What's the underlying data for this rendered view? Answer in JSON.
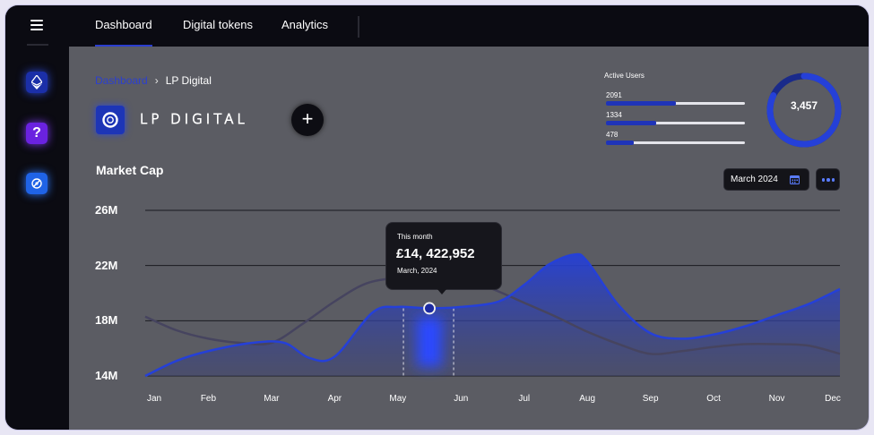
{
  "header": {
    "tabs": [
      {
        "label": "Dashboard",
        "active": true
      },
      {
        "label": "Digital tokens",
        "active": false
      },
      {
        "label": "Analytics",
        "active": false
      }
    ]
  },
  "sidebar": {
    "items": [
      {
        "icon": "ethereum-icon"
      },
      {
        "icon": "help-icon",
        "glyph": "?"
      },
      {
        "icon": "swap-icon"
      }
    ]
  },
  "breadcrumb": {
    "root": "Dashboard",
    "separator": "›",
    "current": "LP Digital"
  },
  "brand": {
    "name": "LP DIGITAL",
    "add_label": "+"
  },
  "active_users": {
    "title": "Active Users",
    "rows": [
      {
        "value": "2091",
        "fraction": 0.5
      },
      {
        "value": "1334",
        "fraction": 0.36
      },
      {
        "value": "478",
        "fraction": 0.2
      }
    ],
    "total": "3,457",
    "gauge_fraction": 0.82
  },
  "market_cap": {
    "title": "Market Cap",
    "date_select": "March 2024"
  },
  "tooltip": {
    "label": "This month",
    "value": "£14, 422,952",
    "date": "March, 2024"
  },
  "colors": {
    "accent": "#2b3fd0",
    "series_primary": "#2540d8",
    "series_secondary": "#4a4868",
    "background": "#5b5c63",
    "sidebar": "#0b0b12"
  },
  "chart_data": {
    "type": "area",
    "title": "Market Cap",
    "categories": [
      "Jan",
      "Feb",
      "Mar",
      "Apr",
      "May",
      "Jun",
      "Jul",
      "Aug",
      "Sep",
      "Oct",
      "Nov",
      "Dec"
    ],
    "y_ticks": [
      "26M",
      "22M",
      "18M",
      "14M"
    ],
    "ylim": [
      14,
      26
    ],
    "grid": true,
    "highlight_index": 4.5,
    "series": [
      {
        "style": "area",
        "x": [
          0,
          0.5,
          1,
          1.7,
          2.2,
          2.6,
          3,
          3.6,
          4,
          4.5,
          5,
          5.6,
          6,
          6.4,
          6.8,
          7,
          7.5,
          8,
          8.5,
          9,
          9.5,
          10,
          10.5,
          11
        ],
        "values": [
          14,
          15.1,
          15.8,
          16.4,
          16.4,
          15.3,
          15.4,
          18.6,
          19,
          18.9,
          19,
          19.4,
          20.6,
          22.1,
          22.8,
          22.3,
          19.1,
          17.1,
          16.7,
          17,
          17.6,
          18.4,
          19.2,
          20.3
        ]
      },
      {
        "style": "line",
        "x": [
          0,
          0.5,
          1,
          1.5,
          2,
          2.5,
          3,
          3.5,
          4,
          4.5,
          5,
          5.5,
          6,
          6.5,
          7,
          7.5,
          8,
          8.5,
          9,
          9.5,
          10,
          10.5,
          11
        ],
        "values": [
          18.3,
          17.3,
          16.7,
          16.4,
          16.4,
          17.8,
          19.4,
          20.7,
          21.1,
          21.2,
          21.1,
          20.3,
          19.3,
          18.3,
          17.2,
          16.3,
          15.6,
          15.8,
          16.1,
          16.3,
          16.3,
          16.2,
          15.6
        ]
      }
    ]
  }
}
